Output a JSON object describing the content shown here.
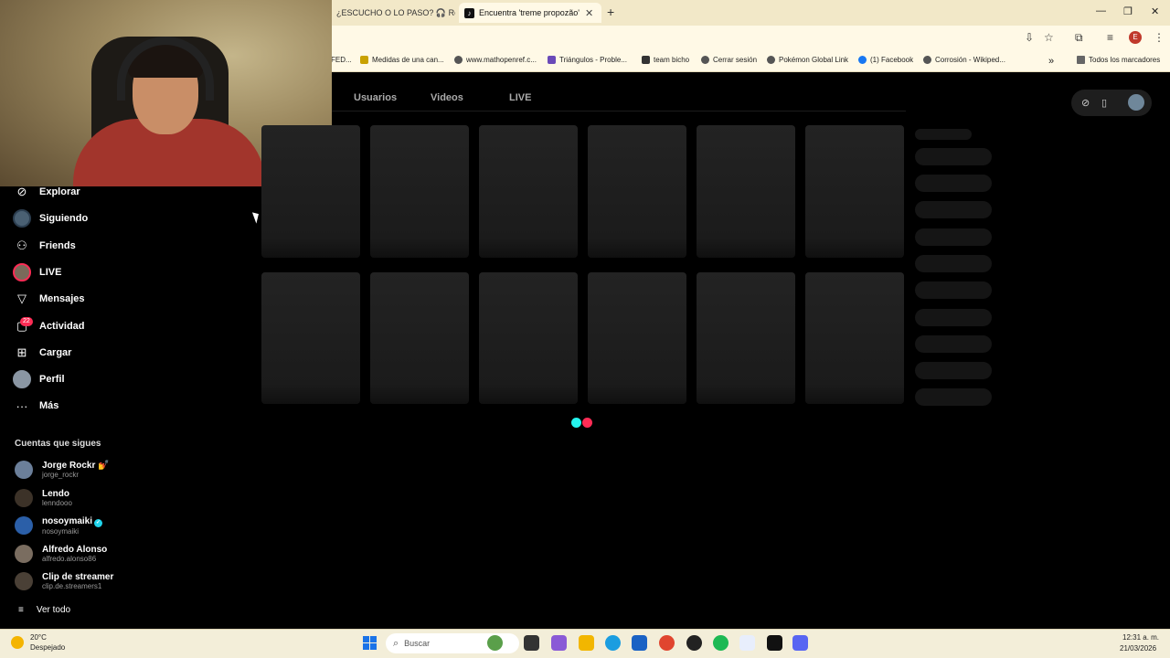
{
  "browser": {
    "tabs": [
      {
        "label": "¿ESCUCHO O LO PASO? 🎧 Rea",
        "active": false
      },
      {
        "label": "Encuentra 'treme propozão' en",
        "active": true
      }
    ],
    "close_glyph": "✕",
    "new_tab_glyph": "+",
    "window_controls": [
      "—",
      "❐",
      "✕"
    ],
    "toolbar_icons": [
      "install-icon",
      "star-icon",
      "extensions-icon",
      "media-icon",
      "profile-icon",
      "menu-icon"
    ],
    "toolbar_glyphs": [
      "⇩",
      "☆",
      "⧉",
      "≡",
      "⋮"
    ],
    "profile_letter": "E",
    "bookmarks": [
      "FED...",
      "Medidas de una can...",
      "www.mathopenref.c...",
      "Triángulos - Proble...",
      "team bicho",
      "Cerrar sesión",
      "Pokémon Global Link",
      "(1) Facebook",
      "Corrosión - Wikiped..."
    ],
    "bookmarks_overflow": "»",
    "all_bookmarks": "Todos los marcadores"
  },
  "search_tabs": [
    "Usuarios",
    "Videos",
    "LIVE"
  ],
  "sidebar": {
    "items": [
      {
        "label": "Explorar",
        "icon": "compass-icon",
        "glyph": "⊘"
      },
      {
        "label": "Siguiendo",
        "icon": "avatar"
      },
      {
        "label": "Friends",
        "icon": "friends-icon",
        "glyph": "⚇"
      },
      {
        "label": "LIVE",
        "icon": "live-avatar"
      },
      {
        "label": "Mensajes",
        "icon": "send-icon",
        "glyph": "▽"
      },
      {
        "label": "Actividad",
        "icon": "inbox-icon",
        "glyph": "▢"
      },
      {
        "label": "Cargar",
        "icon": "upload-icon",
        "glyph": "⊞"
      },
      {
        "label": "Perfil",
        "icon": "avatar"
      },
      {
        "label": "Más",
        "icon": "more-icon",
        "glyph": "···"
      }
    ],
    "activity_badge": "22",
    "following_title": "Cuentas que sigues",
    "accounts": [
      {
        "name": "Jorge Rockr",
        "user": "jorge_rockr",
        "verified": false,
        "emoji": "💅"
      },
      {
        "name": "Lendo",
        "user": "lenndooo",
        "verified": false,
        "emoji": ""
      },
      {
        "name": "nosoymaiki",
        "user": "nosoymaiki",
        "verified": true,
        "emoji": ""
      },
      {
        "name": "Alfredo Alonso",
        "user": "alfredo.alonso86",
        "verified": false,
        "emoji": ""
      },
      {
        "name": "Clip de streamer",
        "user": "clip.de.streamers1",
        "verified": false,
        "emoji": ""
      }
    ],
    "see_all": "Ver todo",
    "see_all_glyph": "≡"
  },
  "taskbar": {
    "weather_temp": "20°C",
    "weather_desc": "Despejado",
    "search_placeholder": "Buscar",
    "search_glyph": "⌕",
    "time": "12:31 a. m.",
    "date": "21/03/2026"
  },
  "colors": {
    "accent_cyan": "#25f4ee",
    "accent_red": "#fe2c55",
    "background": "#000000"
  }
}
